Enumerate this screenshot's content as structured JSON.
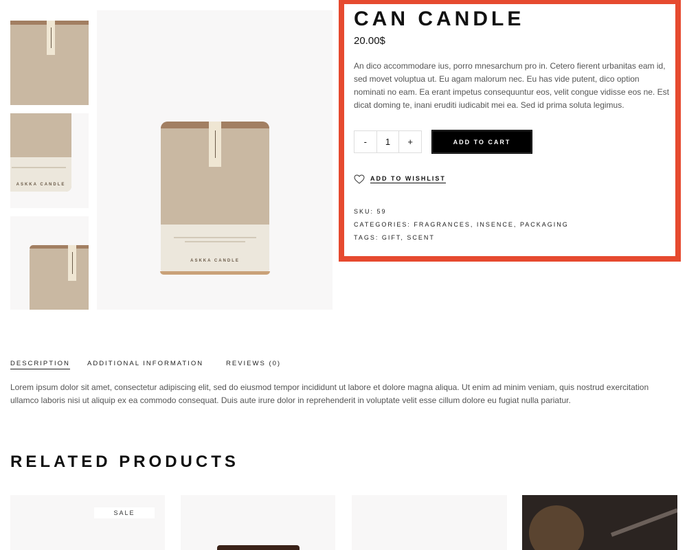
{
  "gallery": {
    "thumb_brand": "ASKKA",
    "main_brand": "ASKKA CANDLE",
    "main_tag": "ASKKA"
  },
  "product": {
    "title": "CAN CANDLE",
    "price": "20.00$",
    "description": "An dico accommodare ius, porro mnesarchum pro in. Cetero fierent urbanitas eam id, sed movet voluptua ut. Eu agam malorum nec. Eu has vide putent, dico option nominati no eam. Ea erant impetus consequuntur eos, velit congue vidisse eos ne. Est dicat doming te, inani eruditi iudicabit mei ea. Sed id prima soluta legimus.",
    "quantity": {
      "minus": "-",
      "value": "1",
      "plus": "+"
    },
    "add_to_cart": "ADD TO CART",
    "wishlist": "ADD TO WISHLIST",
    "sku_label": "SKU:",
    "sku": "59",
    "categories_label": "CATEGORIES:",
    "categories": [
      "FRAGRANCES",
      "INSENCE",
      "PACKAGING"
    ],
    "tags_label": "TAGS:",
    "tags": [
      "GIFT",
      "SCENT"
    ]
  },
  "tabs": {
    "items": [
      "DESCRIPTION",
      "ADDITIONAL INFORMATION",
      "REVIEWS (0)"
    ],
    "active": "DESCRIPTION",
    "content": "Lorem ipsum dolor sit amet, consectetur adipiscing elit, sed do eiusmod tempor incididunt ut labore et dolore magna aliqua. Ut enim ad minim veniam, quis nostrud exercitation ullamco laboris nisi ut aliquip ex ea commodo consequat. Duis aute irure dolor in reprehenderit in voluptate velit esse cillum dolore eu fugiat nulla pariatur."
  },
  "related": {
    "title": "RELATED PRODUCTS",
    "sale_badge": "SALE"
  },
  "colors": {
    "highlight_border": "#e64a2f",
    "button_bg": "#000000",
    "image_bg": "#f8f7f7"
  }
}
